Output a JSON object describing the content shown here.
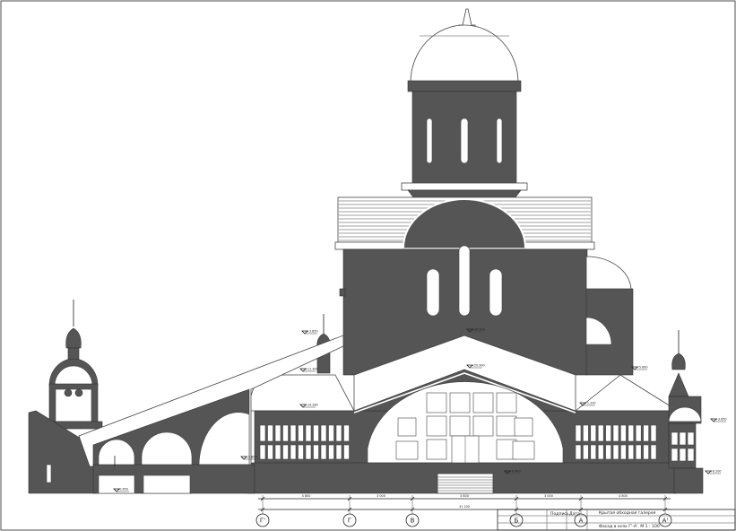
{
  "drawing": {
    "title_block": {
      "line1": "Крытая обходная галерея",
      "line2": "Фасад в осях Г'-А'. М 1 : 100",
      "col_signature": "Подпись",
      "col_date": "Дата"
    },
    "axes": [
      "Г'",
      "Г",
      "В",
      "Б",
      "А",
      "А'"
    ],
    "dimensions": {
      "segments": [
        "4 800",
        "3 000",
        "3 800",
        "3 000",
        "4 800"
      ],
      "total": "31 200"
    },
    "level_marks": [
      "-0.650",
      "+3.850",
      "+11.300",
      "+14.280",
      "+18.500",
      "+20.900",
      "+5.600",
      "+1.200",
      "+0.400",
      "+3.850",
      "+8.200",
      "+5.800"
    ]
  }
}
